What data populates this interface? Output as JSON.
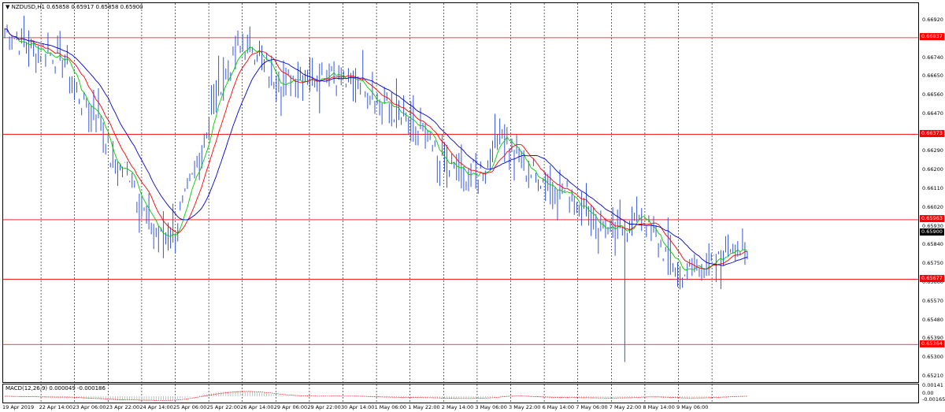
{
  "chart": {
    "symbol_info": "NZDUSD,H1  0.65858 0.65917 0.65858 0.65900",
    "triangle_glyph": "▼"
  },
  "macd": {
    "label": "MACD(12,26,9) 0.000049 -0.000186",
    "axis": [
      "0.00141",
      "0.00",
      "-0.00165"
    ]
  },
  "price_axis": {
    "ticks": [
      "0.66920",
      "0.66830",
      "0.66740",
      "0.66650",
      "0.66560",
      "0.66470",
      "0.66380",
      "0.66290",
      "0.66200",
      "0.66110",
      "0.66020",
      "0.65930",
      "0.65840",
      "0.65750",
      "0.65660",
      "0.65570",
      "0.65480",
      "0.65390",
      "0.65300",
      "0.65210"
    ],
    "current_price": "0.65900",
    "current_price_color": "#000000"
  },
  "levels": [
    {
      "value": 0.66837,
      "label": "0.66837"
    },
    {
      "value": 0.66373,
      "label": "0.66373"
    },
    {
      "value": 0.65963,
      "label": "0.65963"
    },
    {
      "value": 0.65677,
      "label": "0.65677"
    },
    {
      "value": 0.65364,
      "label": "0.65364"
    }
  ],
  "colors": {
    "level_line": "#ff0000",
    "price_bars": "#3355dd",
    "ma_fast": "#00cc00",
    "ma_mid": "#ff0000",
    "ma_slow": "#0000cc",
    "grid": "#000000",
    "macd_hist": "#aaaaaa",
    "macd_signal": "#ff0000"
  },
  "time_axis": [
    "19 Apr 2019",
    "22 Apr 14:00",
    "23 Apr 06:00",
    "23 Apr 22:00",
    "24 Apr 14:00",
    "25 Apr 06:00",
    "25 Apr 22:00",
    "26 Apr 14:00",
    "29 Apr 06:00",
    "29 Apr 22:00",
    "30 Apr 14:00",
    "1 May 06:00",
    "1 May 22:00",
    "2 May 14:00",
    "3 May 06:00",
    "3 May 22:00",
    "6 May 14:00",
    "7 May 06:00",
    "7 May 22:00",
    "8 May 14:00",
    "9 May 06:00"
  ],
  "chart_data": {
    "type": "line",
    "title": "NZDUSD,H1",
    "series": [
      {
        "values": [
          0.6688,
          0.6681,
          0.6679,
          0.6676,
          0.6671,
          0.6652,
          0.6648,
          0.662,
          0.6621,
          0.66,
          0.6587,
          0.6592,
          0.6612,
          0.664,
          0.6664,
          0.6676,
          0.668,
          0.6668,
          0.6662,
          0.6666,
          0.6665,
          0.667,
          0.6662,
          0.6664,
          0.6654,
          0.665,
          0.6641,
          0.6638,
          0.6625,
          0.662,
          0.6617,
          0.662,
          0.664,
          0.6628,
          0.6618,
          0.6615,
          0.661,
          0.6606,
          0.6597,
          0.659,
          0.6591,
          0.66,
          0.6587,
          0.6577,
          0.6571,
          0.6575,
          0.6574,
          0.6586,
          0.6578
        ]
      }
    ],
    "xlim_labels": [
      "19 Apr 2019",
      "9 May 06:00"
    ],
    "ylim": [
      0.6521,
      0.6695
    ]
  }
}
